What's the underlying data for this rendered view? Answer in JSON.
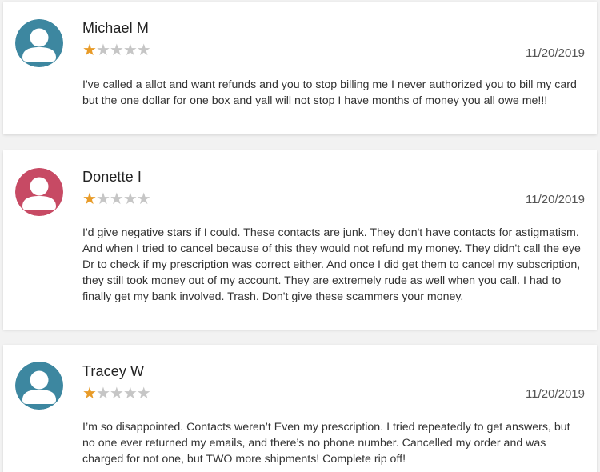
{
  "colors": {
    "star_filled": "#e89b28",
    "star_empty": "#c6c6c6"
  },
  "reviews": [
    {
      "name": "Michael M",
      "rating": 1,
      "max_rating": 5,
      "date": "11/20/2019",
      "avatar_color": "#3d87a0",
      "avatar_icon": "user-avatar-icon",
      "text": "I've called a allot and want refunds and you to stop billing me I never authorized you to bill my card but the one dollar for one box and yall will not stop I have months of money you all owe me!!!"
    },
    {
      "name": "Donette I",
      "rating": 1,
      "max_rating": 5,
      "date": "11/20/2019",
      "avatar_color": "#c74a64",
      "avatar_icon": "user-avatar-icon",
      "text": "I'd give negative stars if I could. These contacts are junk. They don't have contacts for astigmatism. And when I tried to cancel because of this they would not refund my money. They didn't call the eye Dr to check if my prescription was correct either. And once I did get them to cancel my subscription, they still took money out of my account. They are extremely rude as well when you call. I had to finally get my bank involved. Trash. Don't give these scammers your money."
    },
    {
      "name": "Tracey W",
      "rating": 1,
      "max_rating": 5,
      "date": "11/20/2019",
      "avatar_color": "#3d87a0",
      "avatar_icon": "user-avatar-icon",
      "text": "I’m so disappointed. Contacts weren’t Even my prescription. I tried repeatedly to get answers, but no one ever returned my emails, and there’s no phone number. Cancelled my order and was charged for not one, but TWO more shipments! Complete rip off!"
    }
  ]
}
